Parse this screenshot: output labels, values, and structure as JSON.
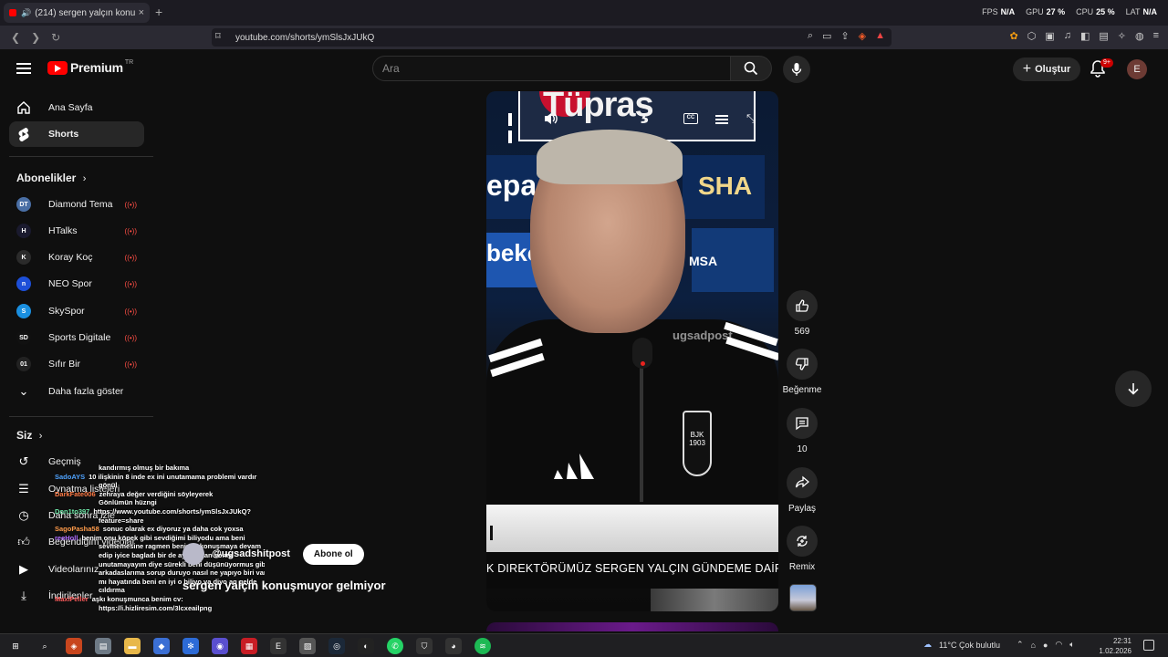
{
  "browser": {
    "tab_title": "(214) sergen yalçın konuşmuy",
    "tab_close": "×",
    "new_tab": "+",
    "url": "youtube.com/shorts/ymSlsJxJUkQ",
    "perf": [
      {
        "label": "FPS",
        "value": "N/A"
      },
      {
        "label": "GPU",
        "value": "27 %"
      },
      {
        "label": "CPU",
        "value": "25 %"
      },
      {
        "label": "LAT",
        "value": "N/A"
      }
    ]
  },
  "header": {
    "logo_text": "Premium",
    "logo_region": "TR",
    "search_placeholder": "Ara",
    "create_label": "Oluştur",
    "notif_badge": "9+",
    "avatar_letter": "E"
  },
  "sidebar": {
    "main": [
      {
        "label": "Ana Sayfa",
        "icon": "home-icon"
      },
      {
        "label": "Shorts",
        "icon": "shorts-icon"
      }
    ],
    "subs_heading": "Abonelikler",
    "subscriptions": [
      {
        "label": "Diamond Tema",
        "color": "#4a6fa5",
        "abbr": "DT"
      },
      {
        "label": "HTalks",
        "color": "#1a1a2e",
        "abbr": "H"
      },
      {
        "label": "Koray Koç",
        "color": "#2b2b2b",
        "abbr": "K"
      },
      {
        "label": "NEO Spor",
        "color": "#1d4fd8",
        "abbr": "n"
      },
      {
        "label": "SkySpor",
        "color": "#1a8fe0",
        "abbr": "S"
      },
      {
        "label": "Sports Digitale",
        "color": "#111111",
        "abbr": "SD"
      },
      {
        "label": "Sıfır Bir",
        "color": "#222222",
        "abbr": "01"
      }
    ],
    "show_more": "Daha fazla göster",
    "you_heading": "Siz",
    "you_items": [
      {
        "label": "Geçmiş",
        "icon": "history-icon"
      },
      {
        "label": "Oynatma listeleri",
        "icon": "playlist-icon"
      },
      {
        "label": "Daha sonra izle",
        "icon": "clock-icon"
      },
      {
        "label": "Beğendiğim videolar",
        "icon": "like-icon"
      },
      {
        "label": "Videolarınız",
        "icon": "video-icon"
      },
      {
        "label": "İndirilenler",
        "icon": "download-icon"
      }
    ]
  },
  "short": {
    "sponsor_top": "Tüpraş",
    "sponsor_left": "epa",
    "sponsor_right": "SHA",
    "sponsor_left2": "beko",
    "sponsor_right2": "MSA",
    "crest_text": "BJK 1903",
    "watermark": "ugsadpost",
    "ticker": "K DIREKTÖRÜMÜZ SERGEN YALÇIN GÜNDEME DAİR A",
    "channel": "@ugsadshitpost",
    "subscribe": "Abone ol",
    "title": "sergen yalçın konuşmuyor gelmiyor"
  },
  "actions": {
    "likes": "569",
    "dislike_label": "Beğenme",
    "comments": "10",
    "share_label": "Paylaş",
    "remix_label": "Remix"
  },
  "chat": [
    {
      "user": "",
      "color": "#ffffff",
      "msg": "kandırmış olmuş bir bakıma"
    },
    {
      "user": "SadoAYS",
      "color": "#4fa3ff",
      "msg": "10 ilişkinin 8 inde ex ini unutamama problemi vardır"
    },
    {
      "user": "",
      "color": "#ffffff",
      "msg": "gönül"
    },
    {
      "user": "DarkFate006",
      "color": "#ff7a45",
      "msg": "zehraya değer verdiğini söyleyerek"
    },
    {
      "user": "",
      "color": "#ffffff",
      "msg": "Gönlümün hüzngi"
    },
    {
      "user": "Don1to397",
      "color": "#6ee7a8",
      "msg": "https://www.youtube.com/shorts/ymSlsJxJUkQ?"
    },
    {
      "user": "",
      "color": "#ffffff",
      "msg": "feature=share"
    },
    {
      "user": "SagoPasha58",
      "color": "#ff9b4a",
      "msg": "sonuc olarak ex diyoruz ya daha cok yoxsa"
    },
    {
      "user": "reeHoll",
      "color": "#b06cff",
      "msg": "benim onu köpek gibi sevdiğimi biliyodu ama beni"
    },
    {
      "user": "",
      "color": "#ffffff",
      "msg": "sevmemesine ragmen benimle konuşmaya devam"
    },
    {
      "user": "",
      "color": "#ffffff",
      "msg": "edip iyice bagladı bir de ayrıldıktan sonra"
    },
    {
      "user": "",
      "color": "#ffffff",
      "msg": "unutamayayım diye sürekli beni düşünüyormus gibi"
    },
    {
      "user": "",
      "color": "#ffffff",
      "msg": "arkadaslarıma sorup duruyo nasıl ne yapıyo biri var"
    },
    {
      "user": "",
      "color": "#ffffff",
      "msg": "mı hayatında beni en iyi o biliyo va diyo aq gelde"
    },
    {
      "user": "",
      "color": "#ffffff",
      "msg": "cıldırma"
    },
    {
      "user": "MaxiFeller",
      "color": "#ff5b5b",
      "msg": "aşkı konuşmunca benim cv:"
    },
    {
      "user": "",
      "color": "#ffffff",
      "msg": "https://i.hizliresim.com/3lcxeailpng"
    }
  ],
  "taskbar": {
    "weather": "11°C  Çok bulutlu",
    "time": "22:31",
    "date": "1.02.2026"
  }
}
